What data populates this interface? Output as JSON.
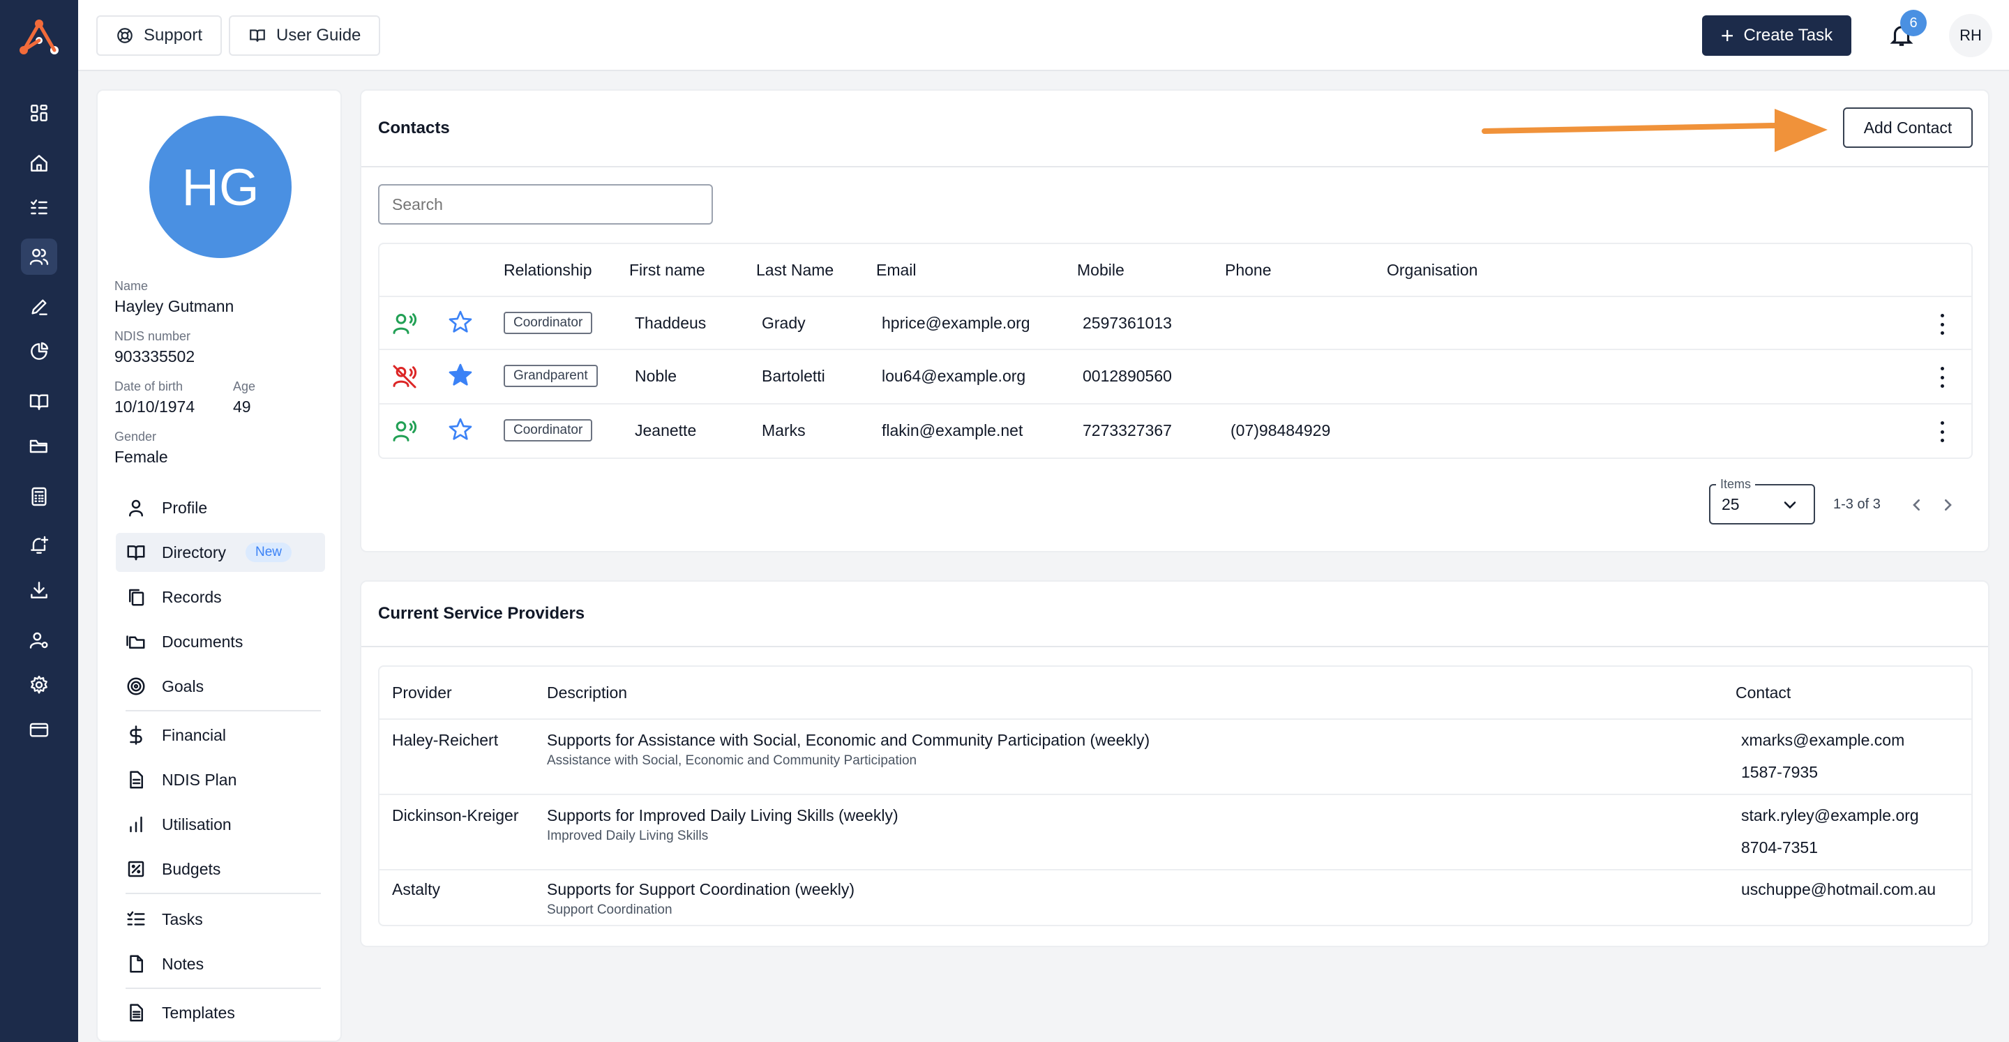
{
  "topbar": {
    "support_label": "Support",
    "user_guide_label": "User Guide",
    "create_task_label": "Create Task",
    "notification_count": "6",
    "user_initials": "RH"
  },
  "rail": {
    "icons": [
      "dashboard-icon",
      "home-icon",
      "checklist-icon",
      "users-icon",
      "pen-icon",
      "pie-chart-icon",
      "book-icon",
      "folder-icon",
      "calculator-icon",
      "bell-plus-icon",
      "download-icon",
      "user-settings-icon",
      "gear-icon",
      "credit-card-icon"
    ],
    "active": "users-icon"
  },
  "profile": {
    "initials": "HG",
    "name_label": "Name",
    "name": "Hayley Gutmann",
    "ndis_label": "NDIS number",
    "ndis": "903335502",
    "dob_label": "Date of birth",
    "dob": "10/10/1974",
    "age_label": "Age",
    "age": "49",
    "gender_label": "Gender",
    "gender": "Female",
    "nav": [
      {
        "label": "Profile"
      },
      {
        "label": "Directory",
        "badge": "New"
      },
      {
        "label": "Records"
      },
      {
        "label": "Documents"
      },
      {
        "label": "Goals"
      },
      {
        "label": "Financial"
      },
      {
        "label": "NDIS Plan"
      },
      {
        "label": "Utilisation"
      },
      {
        "label": "Budgets"
      },
      {
        "label": "Tasks"
      },
      {
        "label": "Notes"
      },
      {
        "label": "Templates"
      }
    ],
    "active_nav": "Directory"
  },
  "contacts": {
    "title": "Contacts",
    "add_label": "Add Contact",
    "search_placeholder": "Search",
    "columns": [
      "Relationship",
      "First name",
      "Last Name",
      "Email",
      "Mobile",
      "Phone",
      "Organisation"
    ],
    "rows": [
      {
        "status": "contactable",
        "starred": false,
        "relationship": "Coordinator",
        "first": "Thaddeus",
        "last": "Grady",
        "email": "hprice@example.org",
        "mobile": "2597361013",
        "phone": "",
        "organisation": ""
      },
      {
        "status": "not-contactable",
        "starred": true,
        "relationship": "Grandparent",
        "first": "Noble",
        "last": "Bartoletti",
        "email": "lou64@example.org",
        "mobile": "0012890560",
        "phone": "",
        "organisation": ""
      },
      {
        "status": "contactable",
        "starred": false,
        "relationship": "Coordinator",
        "first": "Jeanette",
        "last": "Marks",
        "email": "flakin@example.net",
        "mobile": "7273327367",
        "phone": "(07)98484929",
        "organisation": ""
      }
    ],
    "items_label": "Items",
    "items_value": "25",
    "range": "1-3 of 3"
  },
  "providers": {
    "title": "Current Service Providers",
    "columns": [
      "Provider",
      "Description",
      "Contact"
    ],
    "rows": [
      {
        "provider": "Haley-Reichert",
        "description": "Supports for Assistance with Social, Economic and Community Participation (weekly)",
        "sub": "Assistance with Social, Economic and Community Participation",
        "contact": [
          "xmarks@example.com",
          "1587-7935"
        ]
      },
      {
        "provider": "Dickinson-Kreiger",
        "description": "Supports for Improved Daily Living Skills (weekly)",
        "sub": "Improved Daily Living Skills",
        "contact": [
          "stark.ryley@example.org",
          "8704-7351"
        ]
      },
      {
        "provider": "Astalty",
        "description": "Supports for Support Coordination (weekly)",
        "sub": "Support Coordination",
        "contact": [
          "uschuppe@hotmail.com.au"
        ]
      }
    ]
  },
  "colors": {
    "rail": "#1c2b4a",
    "primary_button": "#1c2b4a",
    "avatar": "#4a90e2",
    "annotation_arrow": "#f0923a",
    "contactable": "#22a055",
    "not_contactable": "#dc2626",
    "star": "#3b82f6"
  }
}
